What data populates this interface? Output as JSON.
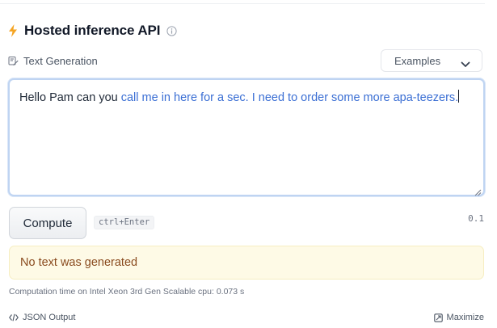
{
  "header": {
    "title": "Hosted inference API",
    "icons": {
      "bolt": "bolt-icon",
      "info": "info-icon"
    }
  },
  "task": {
    "label": "Text Generation",
    "icon": "text-generation-icon"
  },
  "examples": {
    "label": "Examples",
    "icon": "chevron-down-icon"
  },
  "input": {
    "prompt_text": "Hello Pam can you ",
    "completion_text": "call me in here for a sec. I need to order some more apa-teezers."
  },
  "actions": {
    "compute_label": "Compute",
    "shortcut": "ctrl+Enter",
    "time_value": "0.1"
  },
  "result": {
    "message": "No text was generated"
  },
  "footer": {
    "computation_info": "Computation time on Intel Xeon 3rd Gen Scalable cpu: 0.073 s",
    "json_output_label": "JSON Output",
    "maximize_label": "Maximize"
  },
  "colors": {
    "completion_text": "#3b6fd4",
    "bolt": "#f5a524",
    "notice_bg": "#fefae6",
    "notice_text": "#8a4b1f"
  }
}
